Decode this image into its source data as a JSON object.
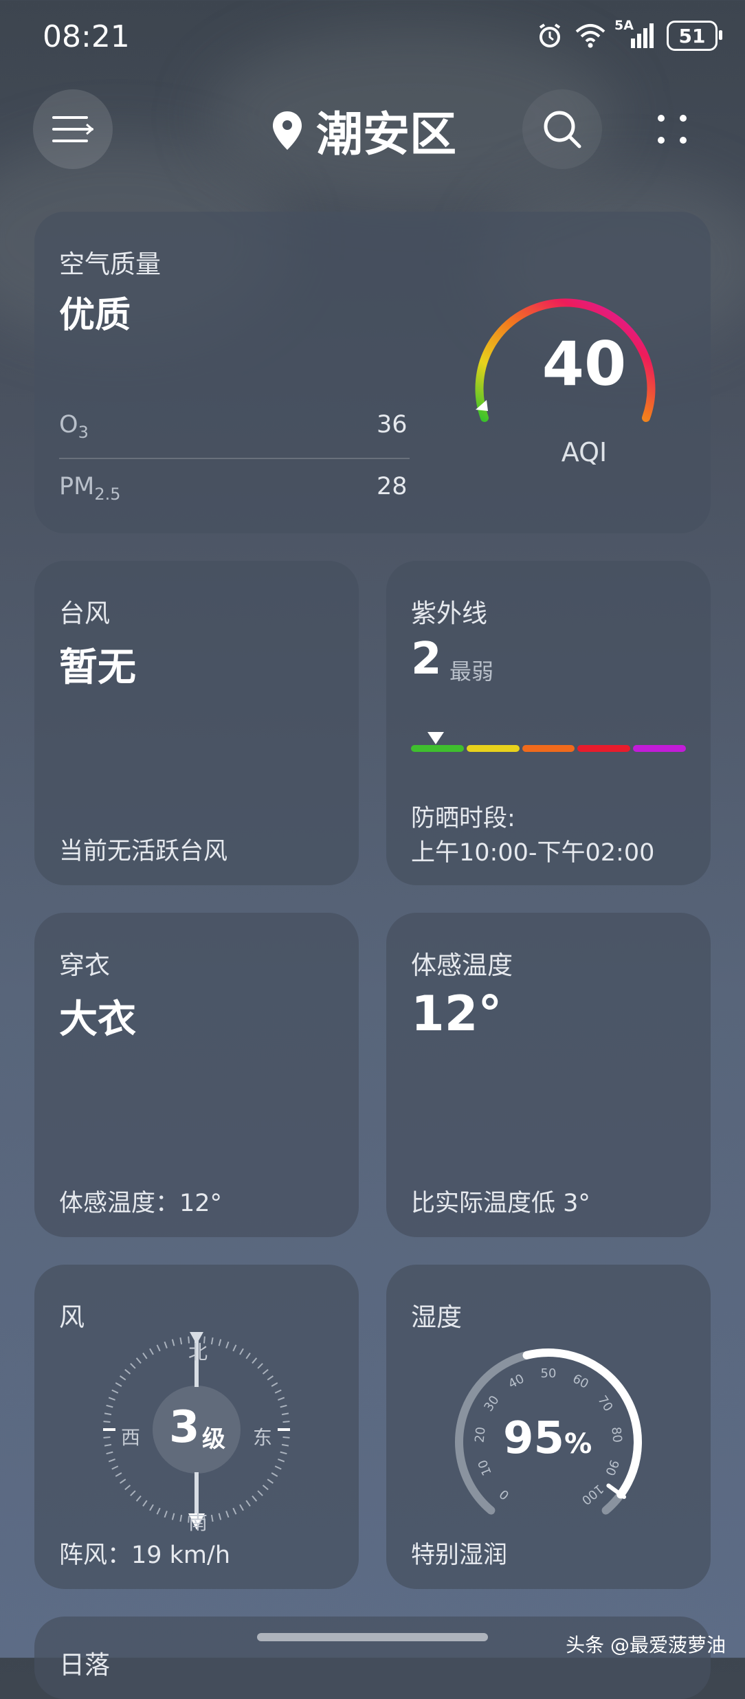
{
  "status": {
    "time": "08:21",
    "network": "5A",
    "battery": "51"
  },
  "header": {
    "location": "潮安区"
  },
  "air": {
    "title": "空气质量",
    "level": "优质",
    "o3_label": "O",
    "o3_sub": "3",
    "o3_value": "36",
    "pm_label": "PM",
    "pm_sub": "2.5",
    "pm_value": "28",
    "aqi": "40",
    "aqi_label": "AQI",
    "aqi_fraction": 0.08
  },
  "typhoon": {
    "title": "台风",
    "value": "暂无",
    "note": "当前无活跃台风"
  },
  "uv": {
    "title": "紫外线",
    "value": "2",
    "level": "最弱",
    "note_label": "防晒时段:",
    "note_time": "上午10:00-下午02:00",
    "scale_colors": [
      "#3fbf2e",
      "#e8d21c",
      "#f06a1c",
      "#e81c2c",
      "#c21cd8"
    ],
    "marker_fraction": 0.09
  },
  "clothing": {
    "title": "穿衣",
    "value": "大衣",
    "note": "体感温度：12°"
  },
  "feels": {
    "title": "体感温度",
    "value": "12°",
    "note": "比实际温度低 3°"
  },
  "wind": {
    "title": "风",
    "level": "3",
    "level_unit": "级",
    "n": "北",
    "s": "南",
    "e": "东",
    "w": "西",
    "gust": "阵风：19 km/h"
  },
  "humidity": {
    "title": "湿度",
    "value": "95",
    "unit": "%",
    "note": "特别湿润",
    "ticks": [
      "0",
      "10",
      "20",
      "30",
      "40",
      "50",
      "60",
      "70",
      "80",
      "90",
      "100"
    ],
    "fraction": 0.95
  },
  "next": {
    "title": "日落"
  },
  "watermark": "头条 @最爱菠萝油"
}
